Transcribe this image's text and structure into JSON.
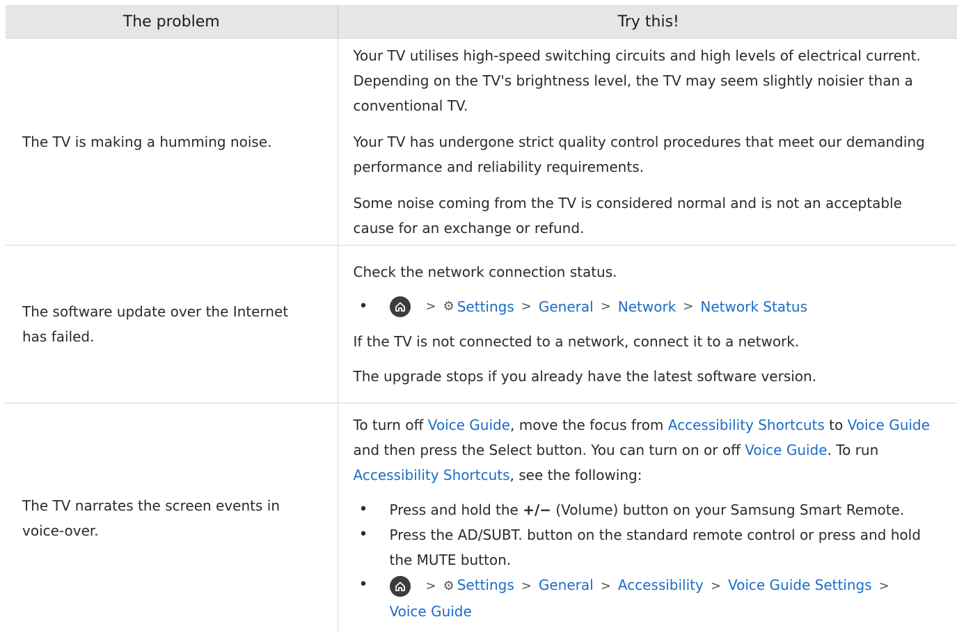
{
  "header": {
    "col1": "The problem",
    "col2": "Try this!"
  },
  "rows": [
    {
      "problem": "The TV is making a humming noise.",
      "solution": {
        "p1": "Your TV utilises high-speed switching circuits and high levels of electrical current. Depending on the TV's brightness level, the TV may seem slightly noisier than a conventional TV.",
        "p2": "Your TV has undergone strict quality control procedures that meet our demanding performance and reliability requirements.",
        "p3": "Some noise coming from the TV is considered normal and is not an acceptable cause for an exchange or refund."
      }
    },
    {
      "problem": "The software update over the Internet has failed.",
      "solution": {
        "p1": "Check the network connection status.",
        "path": [
          "Settings",
          "General",
          "Network",
          "Network Status"
        ],
        "p2": "If the TV is not connected to a network, connect it to a network.",
        "p3": "The upgrade stops if you already have the latest software version."
      }
    },
    {
      "problem": "The TV narrates the screen events in voice-over.",
      "solution": {
        "intro": {
          "t1": "To turn off ",
          "l1": "Voice Guide",
          "t2": ", move the focus from ",
          "l2": "Accessibility Shortcuts",
          "t3": " to ",
          "l3": "Voice Guide",
          "t4": " and then press the Select button. You can turn on or off ",
          "l4": "Voice Guide",
          "t5": ". To run ",
          "l5": "Accessibility Shortcuts",
          "t6": ", see the following:"
        },
        "b1": {
          "pre": "Press and hold the ",
          "symbol": "+/−",
          "post": " (Volume) button on your Samsung Smart Remote."
        },
        "b2": "Press the AD/SUBT. button on the standard remote control or press and hold the MUTE button.",
        "path": [
          "Settings",
          "General",
          "Accessibility",
          "Voice Guide Settings",
          "Voice Guide"
        ]
      }
    }
  ],
  "icons": {
    "home": "home-icon",
    "gear": "gear-icon",
    "chevron": "chevron-right-icon"
  },
  "colors": {
    "link": "#1a6cc6",
    "header_bg": "#e6e6e6"
  }
}
